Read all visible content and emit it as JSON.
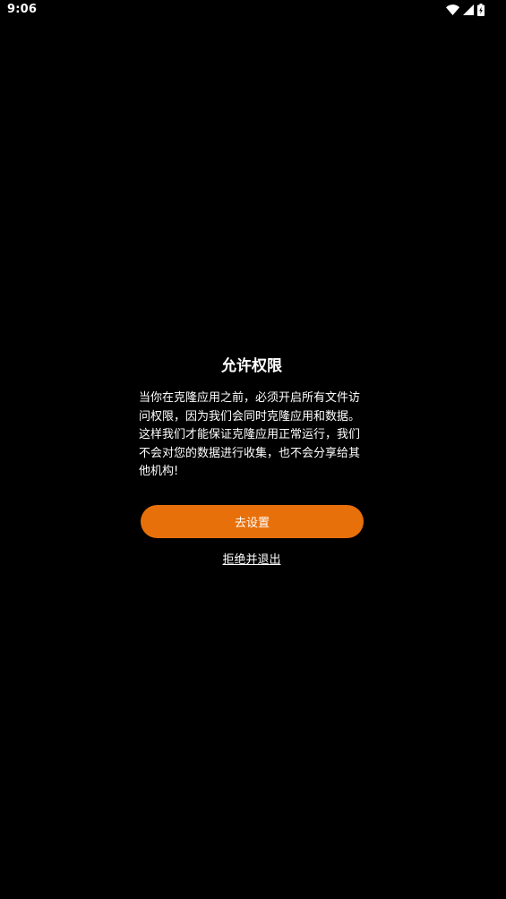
{
  "status_bar": {
    "time": "9:06",
    "icons": [
      "wifi-icon",
      "cellular-signal-icon",
      "battery-charging-icon"
    ]
  },
  "dialog": {
    "title": "允许权限",
    "message": "当你在克隆应用之前，必须开启所有文件访问权限，因为我们会同时克隆应用和数据。这样我们才能保证克隆应用正常运行，我们不会对您的数据进行收集，也不会分享给其他机构!",
    "confirm_label": "去设置",
    "decline_label": "拒绝并退出"
  },
  "colors": {
    "background": "#000000",
    "accent": "#e8700a",
    "text": "#ffffff"
  }
}
